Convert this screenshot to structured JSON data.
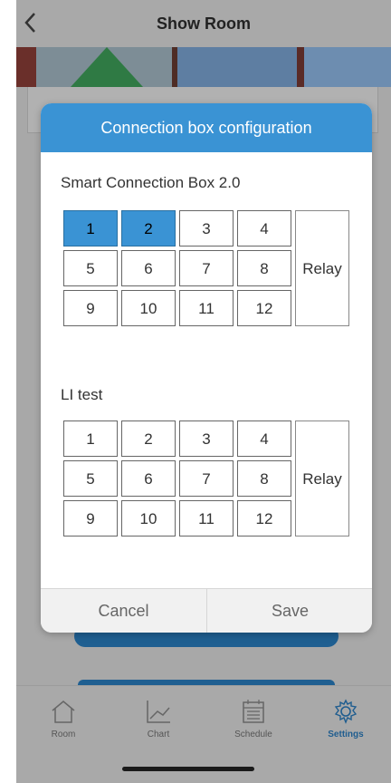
{
  "header": {
    "title": "Show Room",
    "back_icon": "chevron-left-icon"
  },
  "modal": {
    "title": "Connection box configuration",
    "boxes": [
      {
        "name": "Smart Connection Box 2.0",
        "cells": [
          "1",
          "2",
          "3",
          "4",
          "5",
          "6",
          "7",
          "8",
          "9",
          "10",
          "11",
          "12"
        ],
        "selected": [
          "1",
          "2"
        ],
        "relay_label": "Relay"
      },
      {
        "name": "LI test",
        "cells": [
          "1",
          "2",
          "3",
          "4",
          "5",
          "6",
          "7",
          "8",
          "9",
          "10",
          "11",
          "12"
        ],
        "selected": [],
        "relay_label": "Relay"
      }
    ],
    "cancel_label": "Cancel",
    "save_label": "Save"
  },
  "tabs": [
    {
      "label": "Room",
      "icon": "home-icon"
    },
    {
      "label": "Chart",
      "icon": "chart-icon"
    },
    {
      "label": "Schedule",
      "icon": "calendar-icon"
    },
    {
      "label": "Settings",
      "icon": "gear-icon",
      "active": true
    }
  ],
  "colors": {
    "accent": "#3a93d4",
    "active_tab": "#1f5d8f"
  }
}
